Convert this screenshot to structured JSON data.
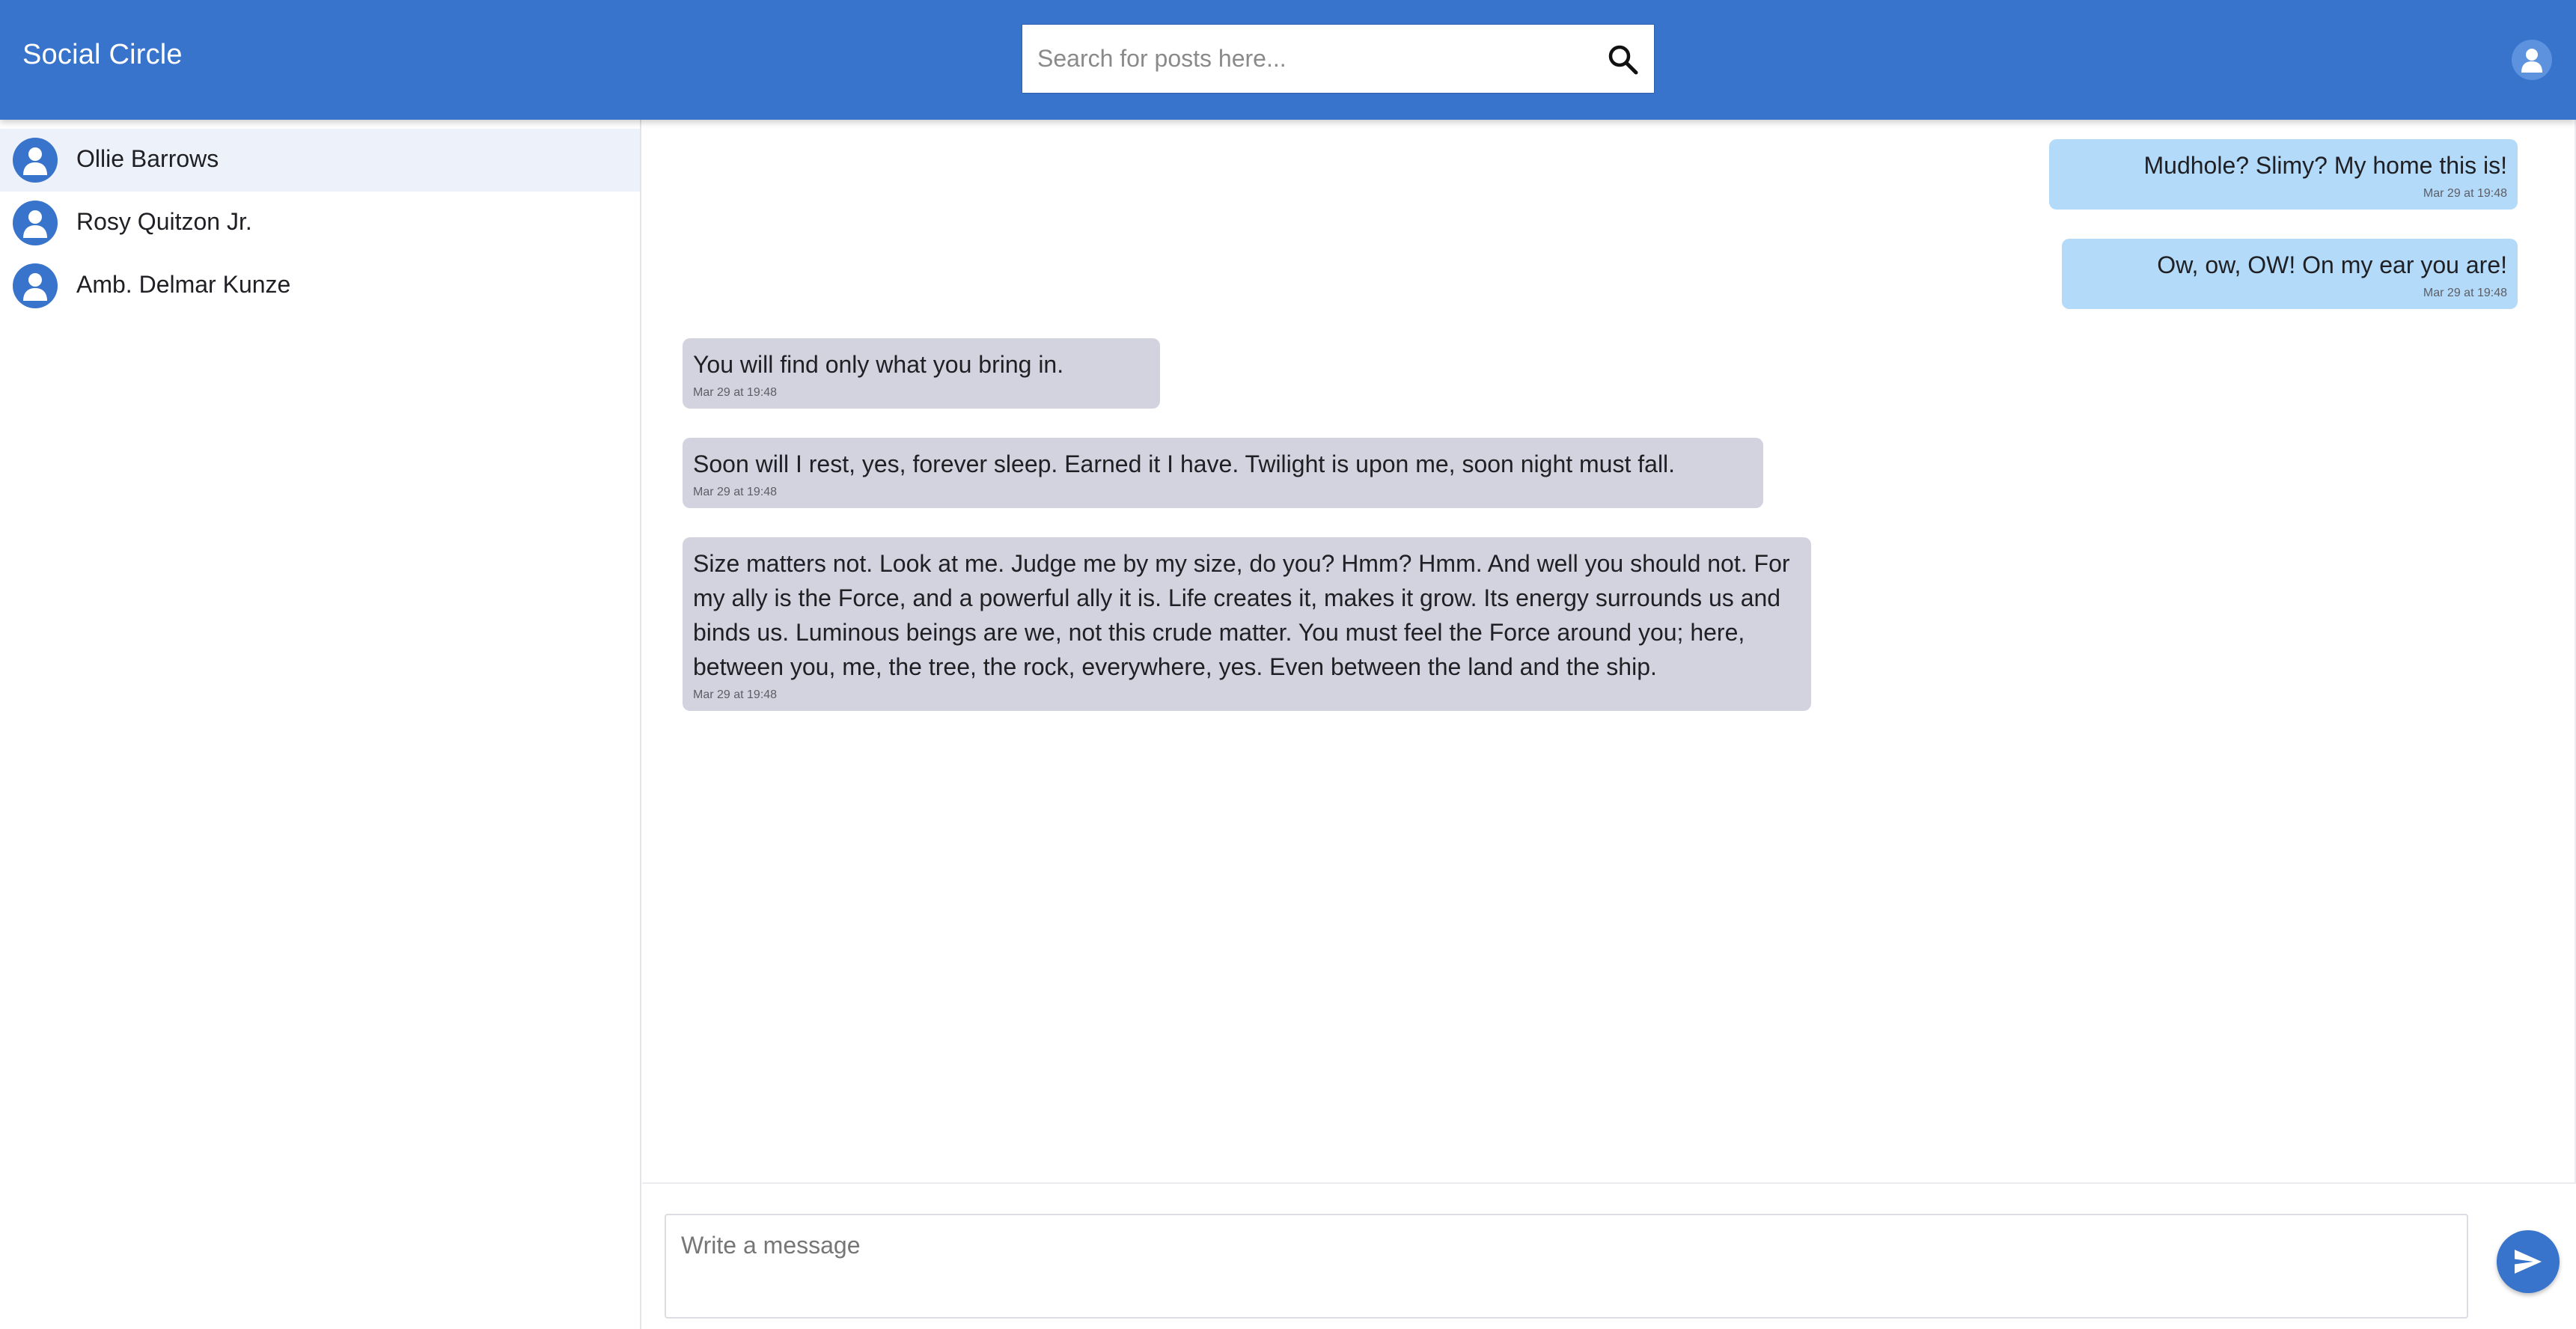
{
  "app": {
    "title": "Social Circle"
  },
  "search": {
    "placeholder": "Search for posts here...",
    "icon": "search-icon"
  },
  "account": {
    "icon": "user-avatar-icon"
  },
  "contacts": [
    {
      "name": "Ollie Barrows",
      "active": true,
      "icon": "user-avatar-icon"
    },
    {
      "name": "Rosy Quitzon Jr.",
      "active": false,
      "icon": "user-avatar-icon"
    },
    {
      "name": "Amb. Delmar Kunze",
      "active": false,
      "icon": "user-avatar-icon"
    }
  ],
  "messages": [
    {
      "direction": "outgoing",
      "text": "Mudhole? Slimy? My home this is!",
      "time": "Mar 29 at 19:48"
    },
    {
      "direction": "outgoing",
      "text": "Ow, ow, OW! On my ear you are!",
      "time": "Mar 29 at 19:48"
    },
    {
      "direction": "incoming",
      "text": "You will find only what you bring in.",
      "time": "Mar 29 at 19:48"
    },
    {
      "direction": "incoming",
      "text": "Soon will I rest, yes, forever sleep. Earned it I have. Twilight is upon me, soon night must fall.",
      "time": "Mar 29 at 19:48"
    },
    {
      "direction": "incoming",
      "text": "Size matters not. Look at me. Judge me by my size, do you? Hmm? Hmm. And well you should not. For my ally is the Force, and a powerful ally it is. Life creates it, makes it grow. Its energy surrounds us and binds us. Luminous beings are we, not this crude matter. You must feel the Force around you; here, between you, me, the tree, the rock, everywhere, yes. Even between the land and the ship.",
      "time": "Mar 29 at 19:48"
    }
  ],
  "composer": {
    "placeholder": "Write a message",
    "send_icon": "send-icon"
  },
  "colors": {
    "primary": "#3873cc",
    "outgoing_bubble": "#b3daf8",
    "incoming_bubble": "#d3d3e0",
    "active_contact": "#edf2fa"
  }
}
